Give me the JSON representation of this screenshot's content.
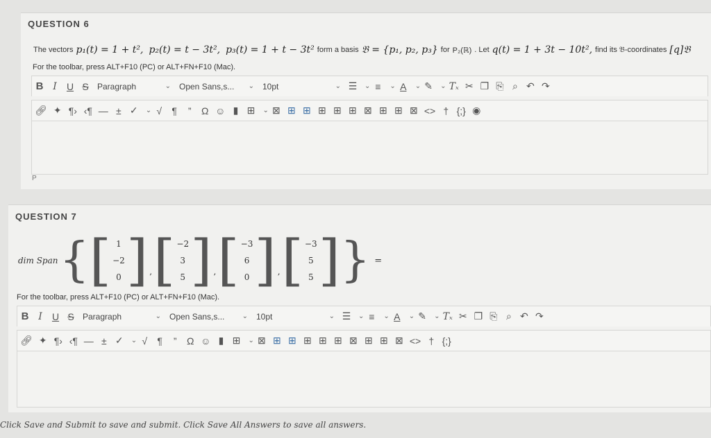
{
  "q6": {
    "title": "QUESTION 6",
    "prompt_lead": "The vectors",
    "p1": "p₁(t) = 1 + t²,",
    "p2": "p₂(t) = t − 3t²,",
    "p3": "p₃(t) = 1 + t − 3t²",
    "form_basis": "form a basis",
    "basis_set": "𝔅 = {p₁, p₂, p₃}",
    "for_text": "for",
    "space": "P₂(ℝ)",
    "let_text": ". Let",
    "q_def": "q(t) = 1 + 3t − 10t²,",
    "find_text": "find its 𝔅-coordinates",
    "coord": "[q]𝔅",
    "hint": "For the toolbar, press ALT+F10 (PC) or ALT+FN+F10 (Mac).",
    "path": "P"
  },
  "q7": {
    "title": "QUESTION 7",
    "dim_label": "dim Span",
    "vectors": [
      [
        "1",
        "−2",
        "0"
      ],
      [
        "−2",
        "3",
        "5"
      ],
      [
        "−3",
        "6",
        "0"
      ],
      [
        "−3",
        "5",
        "5"
      ]
    ],
    "equals": "=",
    "hint": "For the toolbar, press ALT+F10 (PC) or ALT+FN+F10 (Mac)."
  },
  "toolbar": {
    "bold": "B",
    "italic": "I",
    "underline": "U",
    "strike": "S",
    "paragraph": "Paragraph",
    "font": "Open Sans,s...",
    "size": "10pt",
    "chev": "∨"
  },
  "footer": "Click Save and Submit to save and submit. Click Save All Answers to save all answers.",
  "colors": {
    "background": "#e4e4e2",
    "panel": "#f1f1ef",
    "accent_blue": "#3a6ea5"
  }
}
